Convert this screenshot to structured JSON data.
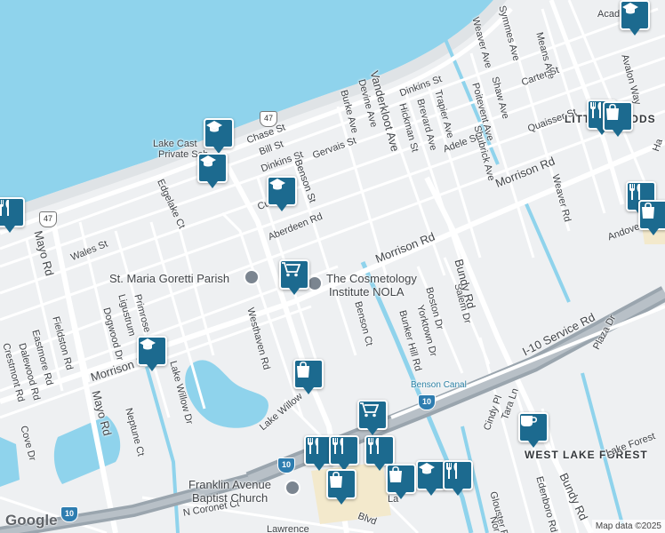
{
  "map": {
    "attribution": "Map data ©2025",
    "logo_text": "Google",
    "colors": {
      "water": "#8fd3ec",
      "land": "#eef0f2",
      "road": "#ffffff",
      "highway": "#9aa5ae",
      "pin": "#1c6a8f"
    },
    "water_labels": [
      "Benson Canal"
    ],
    "area_labels": [
      "LITTLE WOODS",
      "WEST LAKE FOREST"
    ],
    "streets": [
      "Symmes Ave",
      "Means Ave",
      "Weaver Ave",
      "Avalon Way",
      "Carter St",
      "Shaw Ave",
      "Poitevent Ave",
      "Quaisser St",
      "Dinkins St",
      "Trapier Ave",
      "Brevard Ave",
      "Hickman St",
      "Vanderkloot Ave",
      "Devine Ave",
      "Burke Ave",
      "Shubrick Ave",
      "Adele St",
      "Chase St",
      "Bill St",
      "Gervais St",
      "Dinkins St",
      "Benson St",
      "Edgelake Ct",
      "Morrison Rd",
      "Morrison Rd",
      "Morrison Rd",
      "Weaver Rd",
      "Andover",
      "Aberdeen Rd",
      "Cur",
      "Wales St",
      "Mayo Rd",
      "Ligustrum",
      "Primrose",
      "Dogwood Dr",
      "Fieldston Rd",
      "Eastmore Rd",
      "Dalewood Rd",
      "Crestmont Rd",
      "Lake Willow Dr",
      "Westhaven Rd",
      "Benson Ct",
      "Boston Dr",
      "Bunker Hill Rd",
      "Yorktown Dr",
      "Salem Dr",
      "Bundy Rd",
      "I-10 Service Rd",
      "Plaza Dr",
      "Tara Ln",
      "Cindy Pl",
      "Lake Forest",
      "Neptune Ct",
      "Mayo Rd",
      "Cove Dr",
      "Lake Willow",
      "N Coronet Ct",
      "Glouster Rd",
      "Edenboro Rd",
      "Bundy Rd",
      "Lawrence",
      "Blvd",
      "La",
      "Nor",
      "Ha",
      "Acad"
    ],
    "places": [
      "Lake Cast",
      "Private Sch",
      "St. Maria Goretti Parish",
      "The Cosmetology",
      "Institute NOLA",
      "Franklin Avenue",
      "Baptist Church"
    ],
    "shields": [
      "47",
      "47",
      "10",
      "10",
      "10"
    ],
    "markers": [
      {
        "kind": "school-icon"
      },
      {
        "kind": "school-icon"
      },
      {
        "kind": "school-icon"
      },
      {
        "kind": "school-icon"
      },
      {
        "kind": "school-icon"
      },
      {
        "kind": "school-icon"
      },
      {
        "kind": "restaurant-icon"
      },
      {
        "kind": "restaurant-icon"
      },
      {
        "kind": "restaurant-icon"
      },
      {
        "kind": "restaurant-icon"
      },
      {
        "kind": "restaurant-icon"
      },
      {
        "kind": "restaurant-icon"
      },
      {
        "kind": "restaurant-icon"
      },
      {
        "kind": "shopping-bag-icon"
      },
      {
        "kind": "shopping-bag-icon"
      },
      {
        "kind": "shopping-bag-icon"
      },
      {
        "kind": "shopping-bag-icon"
      },
      {
        "kind": "shopping-bag-icon"
      },
      {
        "kind": "shopping-cart-icon"
      },
      {
        "kind": "shopping-cart-icon"
      },
      {
        "kind": "cafe-icon"
      }
    ]
  }
}
